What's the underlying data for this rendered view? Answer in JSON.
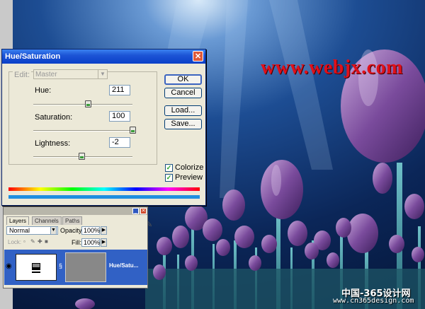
{
  "watermark": {
    "site": "www.webjx.com",
    "cn_site": "中国-365设计网",
    "cn_url": "www.cn365design.com"
  },
  "dialog": {
    "title": "Hue/Saturation",
    "edit_label": "Edit:",
    "edit_value": "Master",
    "hue": {
      "label": "Hue:",
      "value": "211",
      "level": 0.55
    },
    "saturation": {
      "label": "Saturation:",
      "value": "100",
      "level": 1.0
    },
    "lightness": {
      "label": "Lightness:",
      "value": "-2",
      "level": 0.49
    },
    "buttons": {
      "ok": "OK",
      "cancel": "Cancel",
      "load": "Load...",
      "save": "Save..."
    },
    "colorize": {
      "label": "Colorize",
      "checked": true
    },
    "preview": {
      "label": "Preview",
      "checked": true
    }
  },
  "layers": {
    "tabs": [
      "Layers",
      "Channels",
      "Paths"
    ],
    "blend_mode": "Normal",
    "opacity_label": "Opacity:",
    "opacity_value": "100%",
    "lock_label": "Lock:",
    "fill_label": "Fill:",
    "fill_value": "100%",
    "layer_name": "Hue/Satu..."
  },
  "colors": {
    "accent_title": "#0a3fc8",
    "selected_row": "#3161c5",
    "watermark": "#e0101a"
  }
}
